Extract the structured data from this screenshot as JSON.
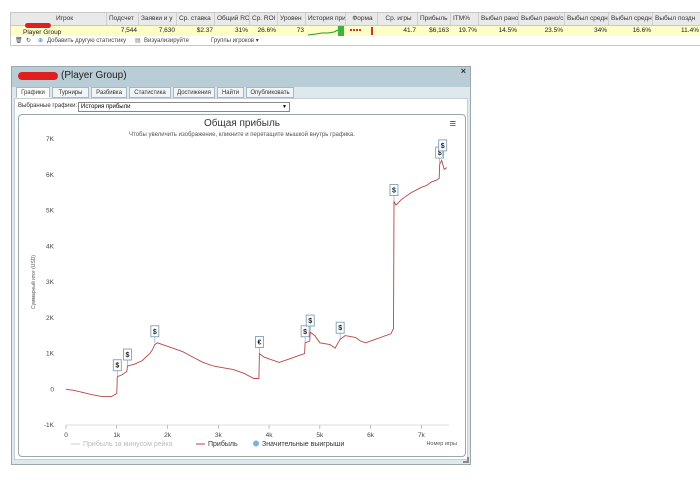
{
  "stats_table": {
    "headers": [
      "Игрок",
      "Подсчет",
      "Заявки и у",
      "Ср. ставка",
      "Общий ROI",
      "Ср. ROI",
      "Уровен",
      "История при",
      "Форма",
      "Ср. игры",
      "Прибыль",
      "ITM%",
      "Выбыл рано",
      "Выбыл рано/с",
      "Выбыл средн",
      "Выбыл средне",
      "Выбыл поздн"
    ],
    "row": {
      "player": "Player Group",
      "values": [
        "7,544",
        "7,630",
        "$2.37",
        "31%",
        "26.6%",
        "73",
        "",
        "",
        "41.7",
        "$6,163",
        "19.7%",
        "14.5%",
        "23.5%",
        "34%",
        "16.6%",
        "11.4%"
      ]
    },
    "toolbar": {
      "add_stats": "Добавить другую статистику",
      "visualize": "Визуализируйте",
      "groups": "Группы игроков ▾"
    }
  },
  "window": {
    "title": "(Player Group)",
    "close_glyph": "×",
    "tabs": [
      "Графики",
      "Турниры",
      "Разбивка",
      "Статистика",
      "Достижения",
      "Найти",
      "Опубликовать"
    ],
    "active_tab": 0,
    "selector_label": "Выбранные графики:",
    "selector_value": "История прибыли"
  },
  "chart_data": {
    "type": "line",
    "title": "Общая прибыль",
    "subtitle": "Чтобы увеличить изображение, кликните и перетащите мышкой внутрь графика.",
    "xlabel": "Номер игры",
    "ylabel": "Суммарный итог (USD)",
    "xlim": [
      0,
      7544
    ],
    "ylim": [
      -1000,
      7000
    ],
    "x_ticks": [
      "0",
      "1k",
      "2k",
      "3k",
      "4k",
      "5k",
      "6k",
      "7k"
    ],
    "y_ticks": [
      "-1K",
      "0",
      "1K",
      "2K",
      "3K",
      "4K",
      "5K",
      "6K",
      "7K"
    ],
    "legend": [
      "Прибыль за минусом рейка",
      "Прибыль",
      "Значительные выигрыши"
    ],
    "legend_position": "bottom",
    "grid": false,
    "series": [
      {
        "name": "Прибыль",
        "color": "#b84545",
        "x": [
          0,
          150,
          300,
          500,
          700,
          900,
          1000,
          1010,
          1100,
          1200,
          1210,
          1350,
          1500,
          1650,
          1700,
          1750,
          1800,
          1900,
          2100,
          2300,
          2500,
          2700,
          2900,
          3100,
          3300,
          3500,
          3700,
          3800,
          3810,
          3900,
          4000,
          4200,
          4400,
          4600,
          4700,
          4710,
          4800,
          4810,
          4900,
          5000,
          5200,
          5300,
          5400,
          5500,
          5700,
          5800,
          5900,
          6100,
          6300,
          6400,
          6450,
          6460,
          6500,
          6600,
          6800,
          7000,
          7100,
          7200,
          7300,
          7350,
          7360,
          7400,
          7450,
          7500
        ],
        "y": [
          0,
          -30,
          -80,
          -150,
          -200,
          -200,
          -120,
          350,
          400,
          500,
          650,
          700,
          800,
          1000,
          1100,
          1250,
          1300,
          1250,
          1150,
          1050,
          900,
          750,
          650,
          600,
          550,
          450,
          300,
          300,
          1000,
          900,
          850,
          750,
          850,
          950,
          1000,
          1300,
          1350,
          1600,
          1500,
          1300,
          1250,
          1150,
          1400,
          1500,
          1450,
          1350,
          1300,
          1400,
          1500,
          1550,
          1700,
          5250,
          5150,
          5300,
          5500,
          5650,
          5700,
          5800,
          5850,
          5900,
          6300,
          6400,
          6150,
          6200
        ]
      },
      {
        "name": "Прибыль за минусом рейка",
        "color": "#cccccc",
        "x": [],
        "y": []
      }
    ],
    "big_wins": [
      {
        "x": 1010,
        "y": 350,
        "symbol": "$"
      },
      {
        "x": 1210,
        "y": 650,
        "symbol": "$"
      },
      {
        "x": 1750,
        "y": 1300,
        "symbol": "$"
      },
      {
        "x": 3810,
        "y": 1000,
        "symbol": "€"
      },
      {
        "x": 4710,
        "y": 1300,
        "symbol": "$"
      },
      {
        "x": 4810,
        "y": 1600,
        "symbol": "$"
      },
      {
        "x": 5400,
        "y": 1400,
        "symbol": "$"
      },
      {
        "x": 6460,
        "y": 5250,
        "symbol": "$"
      },
      {
        "x": 7360,
        "y": 6300,
        "symbol": "$"
      },
      {
        "x": 7420,
        "y": 6500,
        "symbol": "$"
      }
    ]
  }
}
